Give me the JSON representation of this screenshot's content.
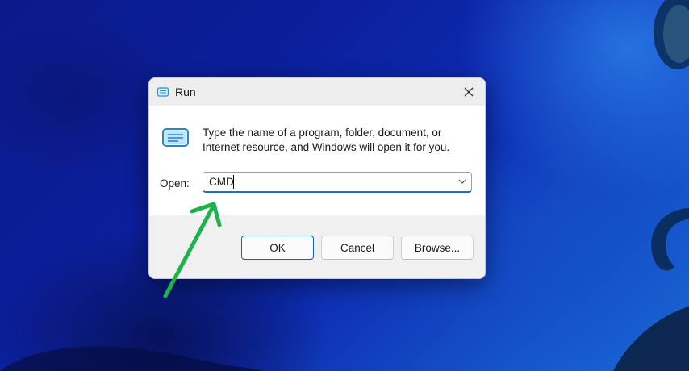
{
  "dialog": {
    "title": "Run",
    "title_icon": "run-icon",
    "close_icon": "close-icon",
    "description": "Type the name of a program, folder, document, or Internet resource, and Windows will open it for you.",
    "open_label": "Open:",
    "open_value": "CMD",
    "buttons": {
      "ok": "OK",
      "cancel": "Cancel",
      "browse": "Browse..."
    }
  },
  "annotation": {
    "arrow_color": "#1bb34a",
    "arrow_icon": "arrow-pointer-icon"
  },
  "colors": {
    "accent": "#1a6fd1",
    "desktop": "#0b1e9a"
  }
}
